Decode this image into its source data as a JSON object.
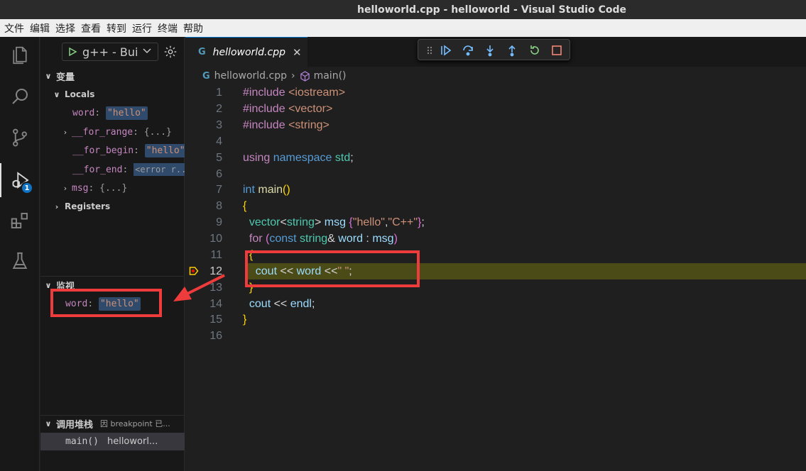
{
  "window": {
    "title": "helloworld.cpp - helloworld - Visual Studio Code"
  },
  "menu": [
    "文件",
    "编辑",
    "选择",
    "查看",
    "转到",
    "运行",
    "终端",
    "帮助"
  ],
  "activity": {
    "debug_badge": "1"
  },
  "run": {
    "config": "g++ - Build"
  },
  "variables": {
    "title": "变量",
    "locals_label": "Locals",
    "registers_label": "Registers",
    "items": [
      {
        "name": "word",
        "value": "\"hello\""
      },
      {
        "name": "__for_range",
        "value": "{...}"
      },
      {
        "name": "__for_begin",
        "value": "\"hello\""
      },
      {
        "name": "__for_end",
        "value": "<error r..."
      },
      {
        "name": "msg",
        "value": "{...}"
      }
    ]
  },
  "watch": {
    "title": "监视",
    "items": [
      {
        "name": "word",
        "value": "\"hello\""
      }
    ]
  },
  "callstack": {
    "title": "调用堆栈",
    "status": "因 breakpoint 已...",
    "frame_func": "main()",
    "frame_file": "helloworl..."
  },
  "editor": {
    "tab_label": "helloworld.cpp",
    "breadcrumb_file": "helloworld.cpp",
    "breadcrumb_symbol": "main()",
    "current_line": 12,
    "line_numbers": [
      "1",
      "2",
      "3",
      "4",
      "5",
      "6",
      "7",
      "8",
      "9",
      "10",
      "11",
      "12",
      "13",
      "14",
      "15",
      "16"
    ]
  },
  "colors": {
    "accent": "#0078d4",
    "highlight": "#4b4b18",
    "annotation": "#ee3c3c"
  }
}
